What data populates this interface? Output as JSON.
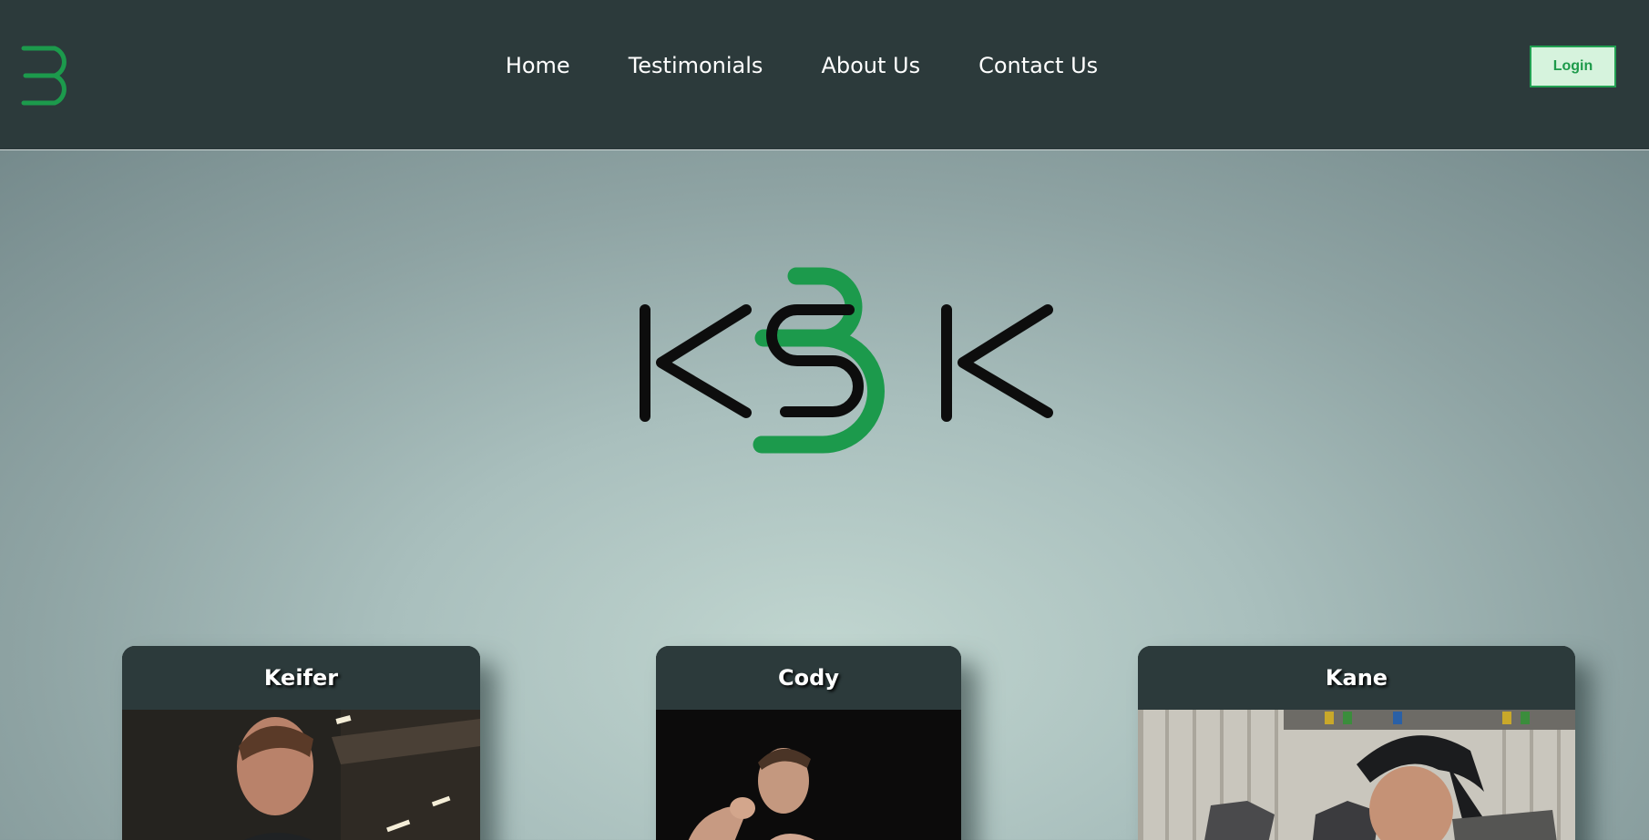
{
  "nav": {
    "links": [
      "Home",
      "Testimonials",
      "About Us",
      "Contact Us"
    ],
    "login_label": "Login",
    "logo_icon": "b-mark-icon"
  },
  "hero": {
    "logo_text": "KBK",
    "logo_icon": "kbk-logo-icon"
  },
  "cards": [
    {
      "name": "Keifer",
      "photo": "trainer-photo"
    },
    {
      "name": "Cody",
      "photo": "trainer-photo"
    },
    {
      "name": "Kane",
      "photo": "trainer-photo"
    }
  ],
  "colors": {
    "nav_bg": "#2c3a3b",
    "brand_green": "#1c9a4c",
    "login_bg": "#d6f3dd",
    "hero_letters": "#0d0d0d"
  }
}
